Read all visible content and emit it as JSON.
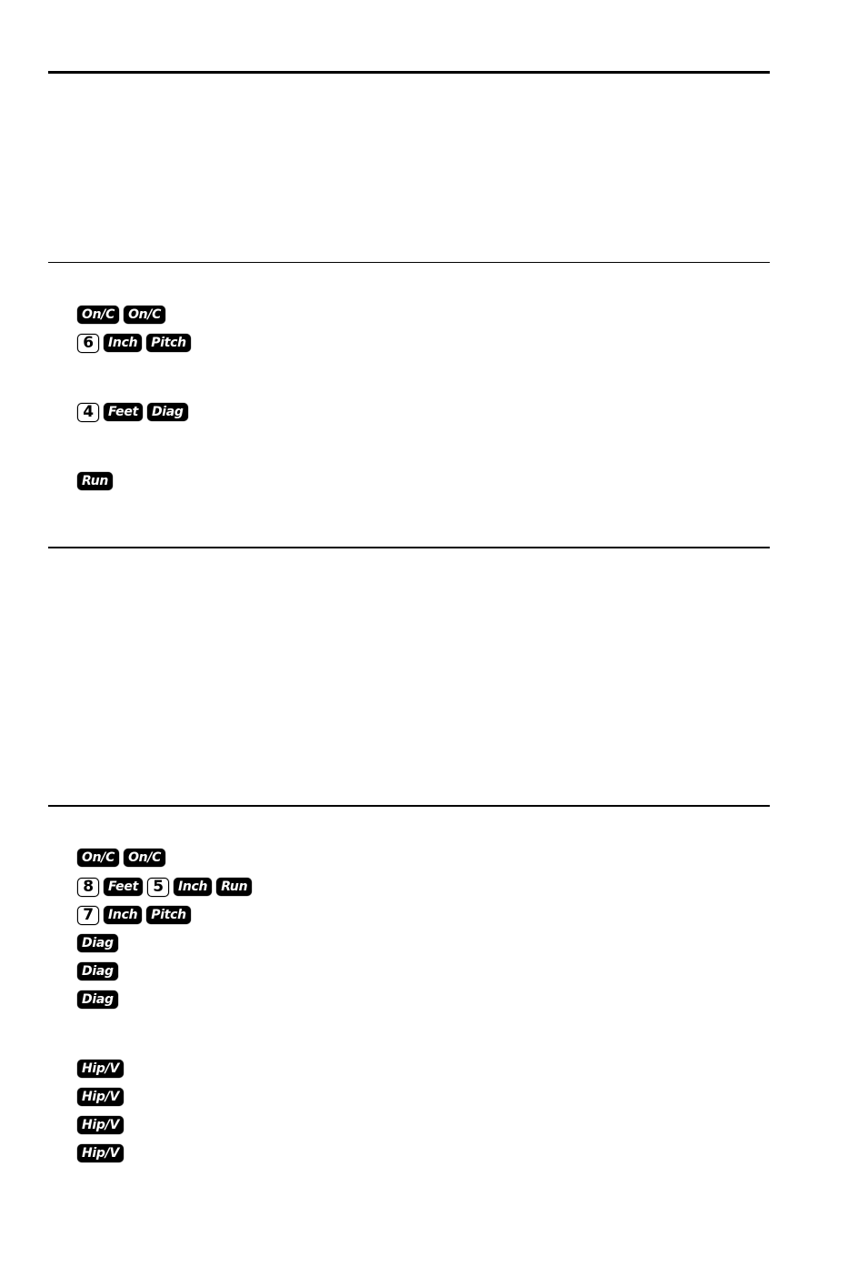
{
  "page": {
    "section1": {
      "rows": [
        [
          "On/C",
          "On/C"
        ],
        [
          "6",
          "Inch",
          "Pitch"
        ],
        [
          "4",
          "Feet",
          "Diag"
        ],
        [
          "Run"
        ]
      ]
    },
    "section2": {
      "rows": [
        [
          "On/C",
          "On/C"
        ],
        [
          "8",
          "Feet",
          "5",
          "Inch",
          "Run"
        ],
        [
          "7",
          "Inch",
          "Pitch"
        ],
        [
          "Diag"
        ],
        [
          "Diag"
        ],
        [
          "Diag"
        ],
        [
          "Hip/V"
        ],
        [
          "Hip/V"
        ],
        [
          "Hip/V"
        ],
        [
          "Hip/V"
        ]
      ]
    }
  }
}
